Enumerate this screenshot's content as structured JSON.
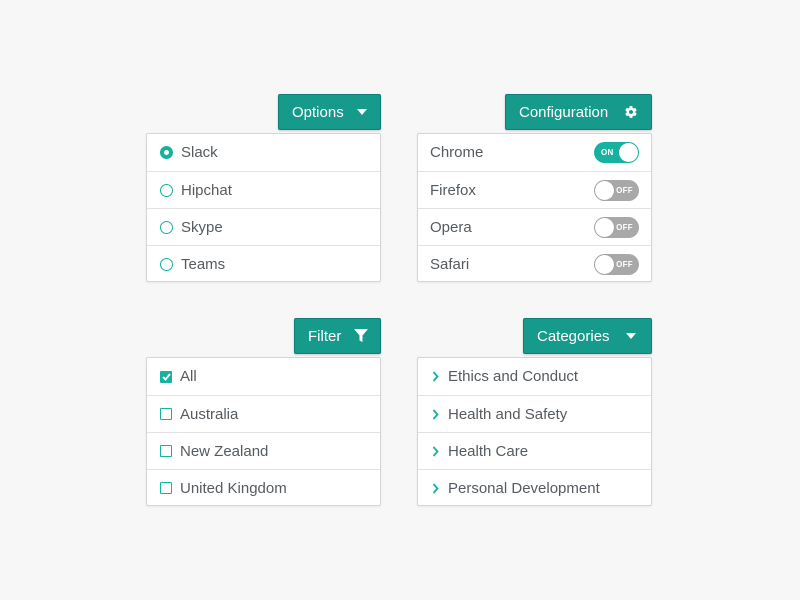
{
  "colors": {
    "accent": "#159a8c",
    "accent_light": "#17b1a0",
    "toggle_off": "#a8a8a8",
    "background": "#f7f7f7"
  },
  "options": {
    "button_label": "Options",
    "button_icon": "caret-down-icon",
    "items": [
      {
        "label": "Slack",
        "selected": true
      },
      {
        "label": "Hipchat",
        "selected": false
      },
      {
        "label": "Skype",
        "selected": false
      },
      {
        "label": "Teams",
        "selected": false
      }
    ]
  },
  "configuration": {
    "button_label": "Configuration",
    "button_icon": "gear-icon",
    "items": [
      {
        "label": "Chrome",
        "state": "ON"
      },
      {
        "label": "Firefox",
        "state": "OFF"
      },
      {
        "label": "Opera",
        "state": "OFF"
      },
      {
        "label": "Safari",
        "state": "OFF"
      }
    ]
  },
  "filter": {
    "button_label": "Filter",
    "button_icon": "funnel-icon",
    "items": [
      {
        "label": "All",
        "checked": true
      },
      {
        "label": "Australia",
        "checked": false
      },
      {
        "label": "New Zealand",
        "checked": false
      },
      {
        "label": "United Kingdom",
        "checked": false
      }
    ]
  },
  "categories": {
    "button_label": "Categories",
    "button_icon": "caret-down-icon",
    "items": [
      {
        "label": "Ethics and Conduct",
        "icon": "chevron-right-icon"
      },
      {
        "label": "Health and Safety",
        "icon": "chevron-right-icon"
      },
      {
        "label": "Health Care",
        "icon": "chevron-right-icon"
      },
      {
        "label": "Personal Development",
        "icon": "chevron-right-icon"
      }
    ]
  }
}
